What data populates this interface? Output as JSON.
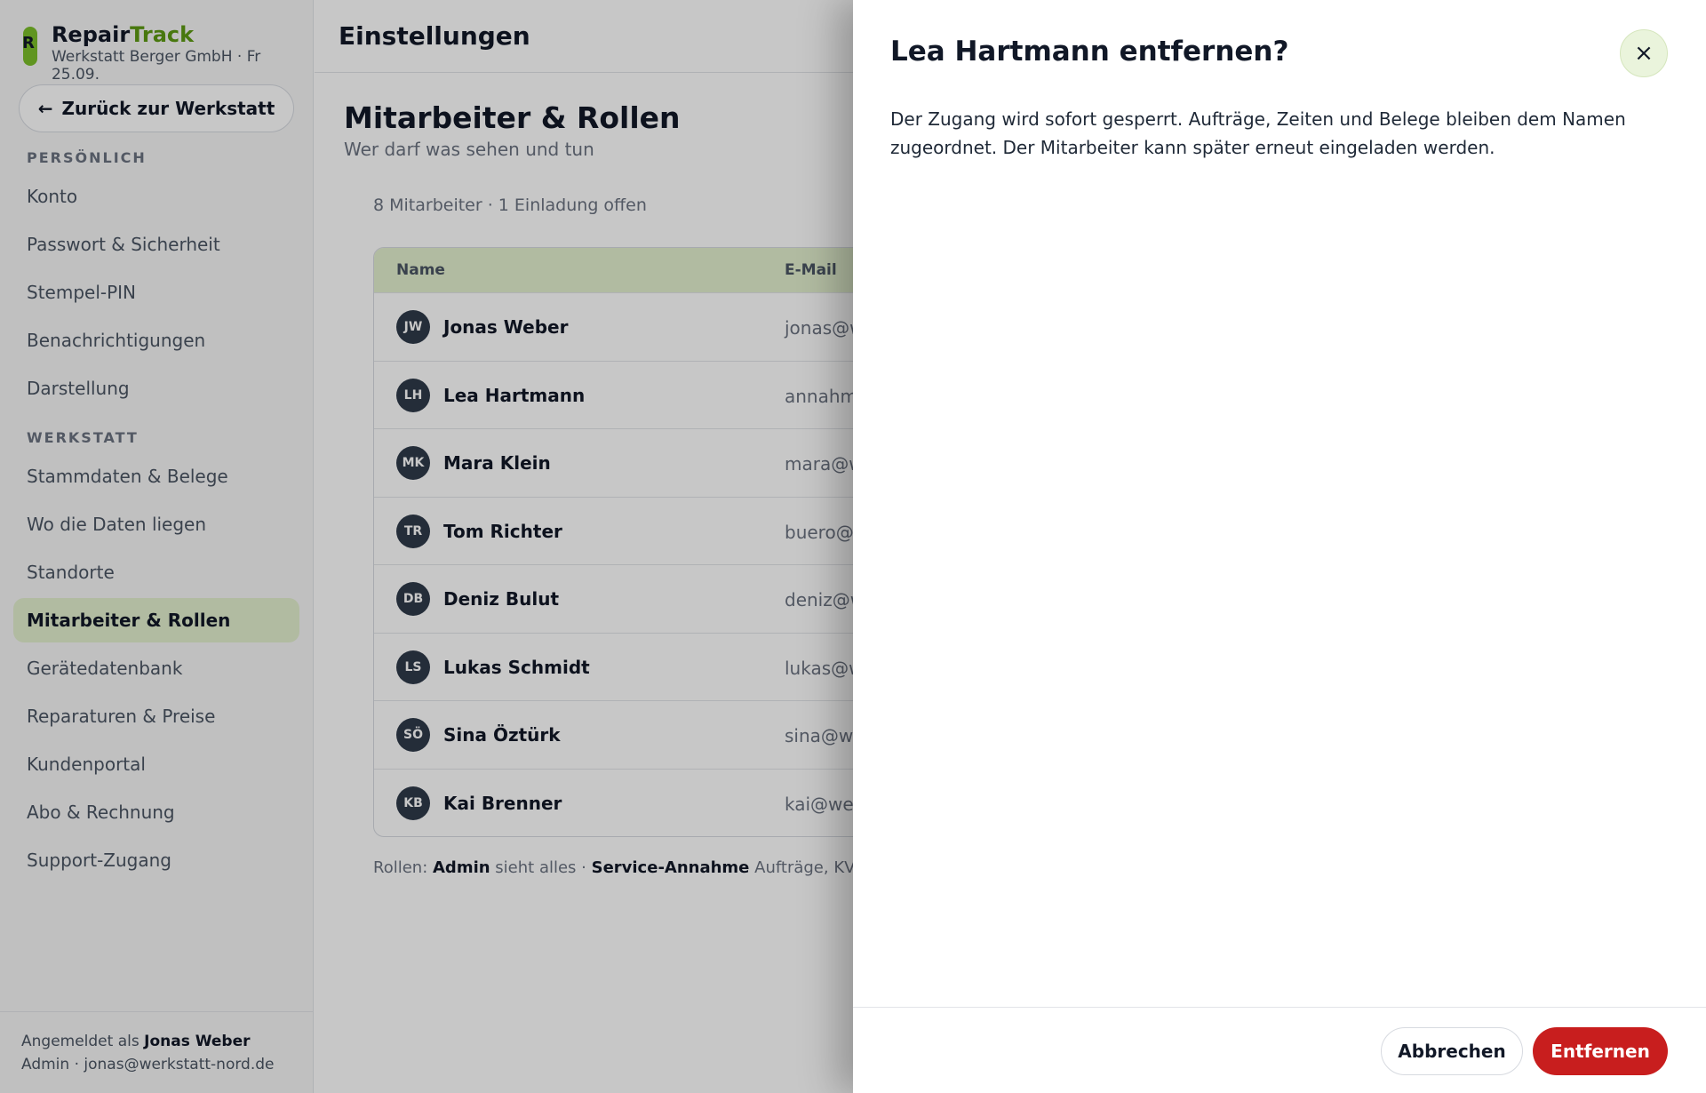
{
  "brand": {
    "logo_letter": "R",
    "name_part1": "Repair",
    "name_part2": "Track",
    "subtitle": "Werkstatt Berger GmbH · Fr 25.09."
  },
  "sidebar": {
    "back_label": "Zurück zur Werkstatt",
    "section_personal": "PERSÖNLICH",
    "personal_items": [
      "Konto",
      "Passwort & Sicherheit",
      "Stempel-PIN",
      "Benachrichtigungen",
      "Darstellung"
    ],
    "section_workshop": "WERKSTATT",
    "workshop_items": [
      "Stammdaten & Belege",
      "Wo die Daten liegen",
      "Standorte",
      "Mitarbeiter & Rollen",
      "Gerätedatenbank",
      "Reparaturen & Preise",
      "Kundenportal",
      "Abo & Rechnung",
      "Support-Zugang"
    ],
    "active_item": "Mitarbeiter & Rollen"
  },
  "footer": {
    "logged_in_prefix": "Angemeldet als",
    "user_name": "Jonas Weber",
    "user_detail": "Admin · jonas@werkstatt-nord.de"
  },
  "topbar": {
    "title": "Einstellungen"
  },
  "main": {
    "title": "Mitarbeiter & Rollen",
    "subtitle": "Wer darf was sehen und tun",
    "count": "8 Mitarbeiter · 1 Einladung offen",
    "table": {
      "headers": [
        "Name",
        "E-Mail"
      ],
      "rows": [
        {
          "initials": "JW",
          "name": "Jonas Weber",
          "email": "jonas@w"
        },
        {
          "initials": "LH",
          "name": "Lea Hartmann",
          "email": "annahm"
        },
        {
          "initials": "MK",
          "name": "Mara Klein",
          "email": "mara@w"
        },
        {
          "initials": "TR",
          "name": "Tom Richter",
          "email": "buero@v"
        },
        {
          "initials": "DB",
          "name": "Deniz Bulut",
          "email": "deniz@w"
        },
        {
          "initials": "LS",
          "name": "Lukas Schmidt",
          "email": "lukas@w"
        },
        {
          "initials": "SÖ",
          "name": "Sina Öztürk",
          "email": "sina@we"
        },
        {
          "initials": "KB",
          "name": "Kai Brenner",
          "email": "kai@wer"
        }
      ]
    },
    "roles_note": {
      "prefix": "Rollen:",
      "role1": "Admin",
      "role1_desc": "sieht alles ·",
      "role2": "Service-Annahme",
      "role2_desc": "Aufträge, KVA,"
    }
  },
  "dialog": {
    "title": "Lea Hartmann entfernen?",
    "body": "Der Zugang wird sofort gesperrt. Aufträge, Zeiten und Belege bleiben dem Namen zugeordnet. Der Mitarbeiter kann später erneut eingeladen werden.",
    "cancel_label": "Abbrechen",
    "confirm_label": "Entfernen",
    "close_icon": "×"
  },
  "colors": {
    "accent": "#7bbf2a",
    "active_bg": "#e3f0cf",
    "danger": "#c81e1e"
  }
}
